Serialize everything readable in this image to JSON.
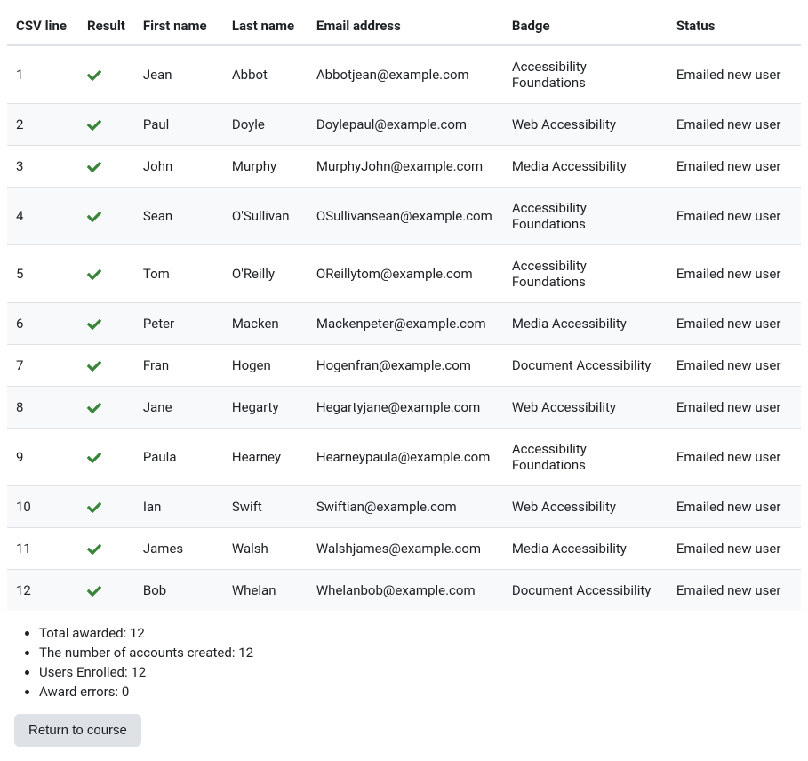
{
  "columns": {
    "csv_line": "CSV line",
    "result": "Result",
    "first_name": "First name",
    "last_name": "Last name",
    "email": "Email address",
    "badge": "Badge",
    "status": "Status"
  },
  "rows": [
    {
      "line": "1",
      "result": "success",
      "first": "Jean",
      "last": "Abbot",
      "email": "Abbotjean@example.com",
      "badge": "Accessibility Foundations",
      "status": "Emailed new user"
    },
    {
      "line": "2",
      "result": "success",
      "first": "Paul",
      "last": "Doyle",
      "email": "Doylepaul@example.com",
      "badge": "Web Accessibility",
      "status": "Emailed new user"
    },
    {
      "line": "3",
      "result": "success",
      "first": "John",
      "last": "Murphy",
      "email": "MurphyJohn@example.com",
      "badge": "Media Accessibility",
      "status": "Emailed new user"
    },
    {
      "line": "4",
      "result": "success",
      "first": "Sean",
      "last": "O'Sullivan",
      "email": "OSullivansean@example.com",
      "badge": "Accessibility Foundations",
      "status": "Emailed new user"
    },
    {
      "line": "5",
      "result": "success",
      "first": "Tom",
      "last": "O'Reilly",
      "email": "OReillytom@example.com",
      "badge": "Accessibility Foundations",
      "status": "Emailed new user"
    },
    {
      "line": "6",
      "result": "success",
      "first": "Peter",
      "last": "Macken",
      "email": "Mackenpeter@example.com",
      "badge": "Media Accessibility",
      "status": "Emailed new user"
    },
    {
      "line": "7",
      "result": "success",
      "first": "Fran",
      "last": "Hogen",
      "email": "Hogenfran@example.com",
      "badge": "Document Accessibility",
      "status": "Emailed new user"
    },
    {
      "line": "8",
      "result": "success",
      "first": "Jane",
      "last": "Hegarty",
      "email": "Hegartyjane@example.com",
      "badge": "Web Accessibility",
      "status": "Emailed new user"
    },
    {
      "line": "9",
      "result": "success",
      "first": "Paula",
      "last": "Hearney",
      "email": "Hearneypaula@example.com",
      "badge": "Accessibility Foundations",
      "status": "Emailed new user"
    },
    {
      "line": "10",
      "result": "success",
      "first": "Ian",
      "last": "Swift",
      "email": "Swiftian@example.com",
      "badge": "Web Accessibility",
      "status": "Emailed new user"
    },
    {
      "line": "11",
      "result": "success",
      "first": "James",
      "last": "Walsh",
      "email": "Walshjames@example.com",
      "badge": "Media Accessibility",
      "status": "Emailed new user"
    },
    {
      "line": "12",
      "result": "success",
      "first": "Bob",
      "last": "Whelan",
      "email": "Whelanbob@example.com",
      "badge": "Document Accessibility",
      "status": "Emailed new user"
    }
  ],
  "summary": {
    "total_awarded_label": "Total awarded: ",
    "total_awarded_value": "12",
    "accounts_created_label": "The number of accounts created: ",
    "accounts_created_value": "12",
    "users_enrolled_label": "Users Enrolled: ",
    "users_enrolled_value": "12",
    "award_errors_label": "Award errors: ",
    "award_errors_value": "0"
  },
  "buttons": {
    "return": "Return to course"
  },
  "colors": {
    "success": "#398439",
    "border": "#dee2e6",
    "bg_alt": "#f8f9fa",
    "button_bg": "#dee2e6"
  },
  "icons": {
    "check": "check-icon"
  }
}
